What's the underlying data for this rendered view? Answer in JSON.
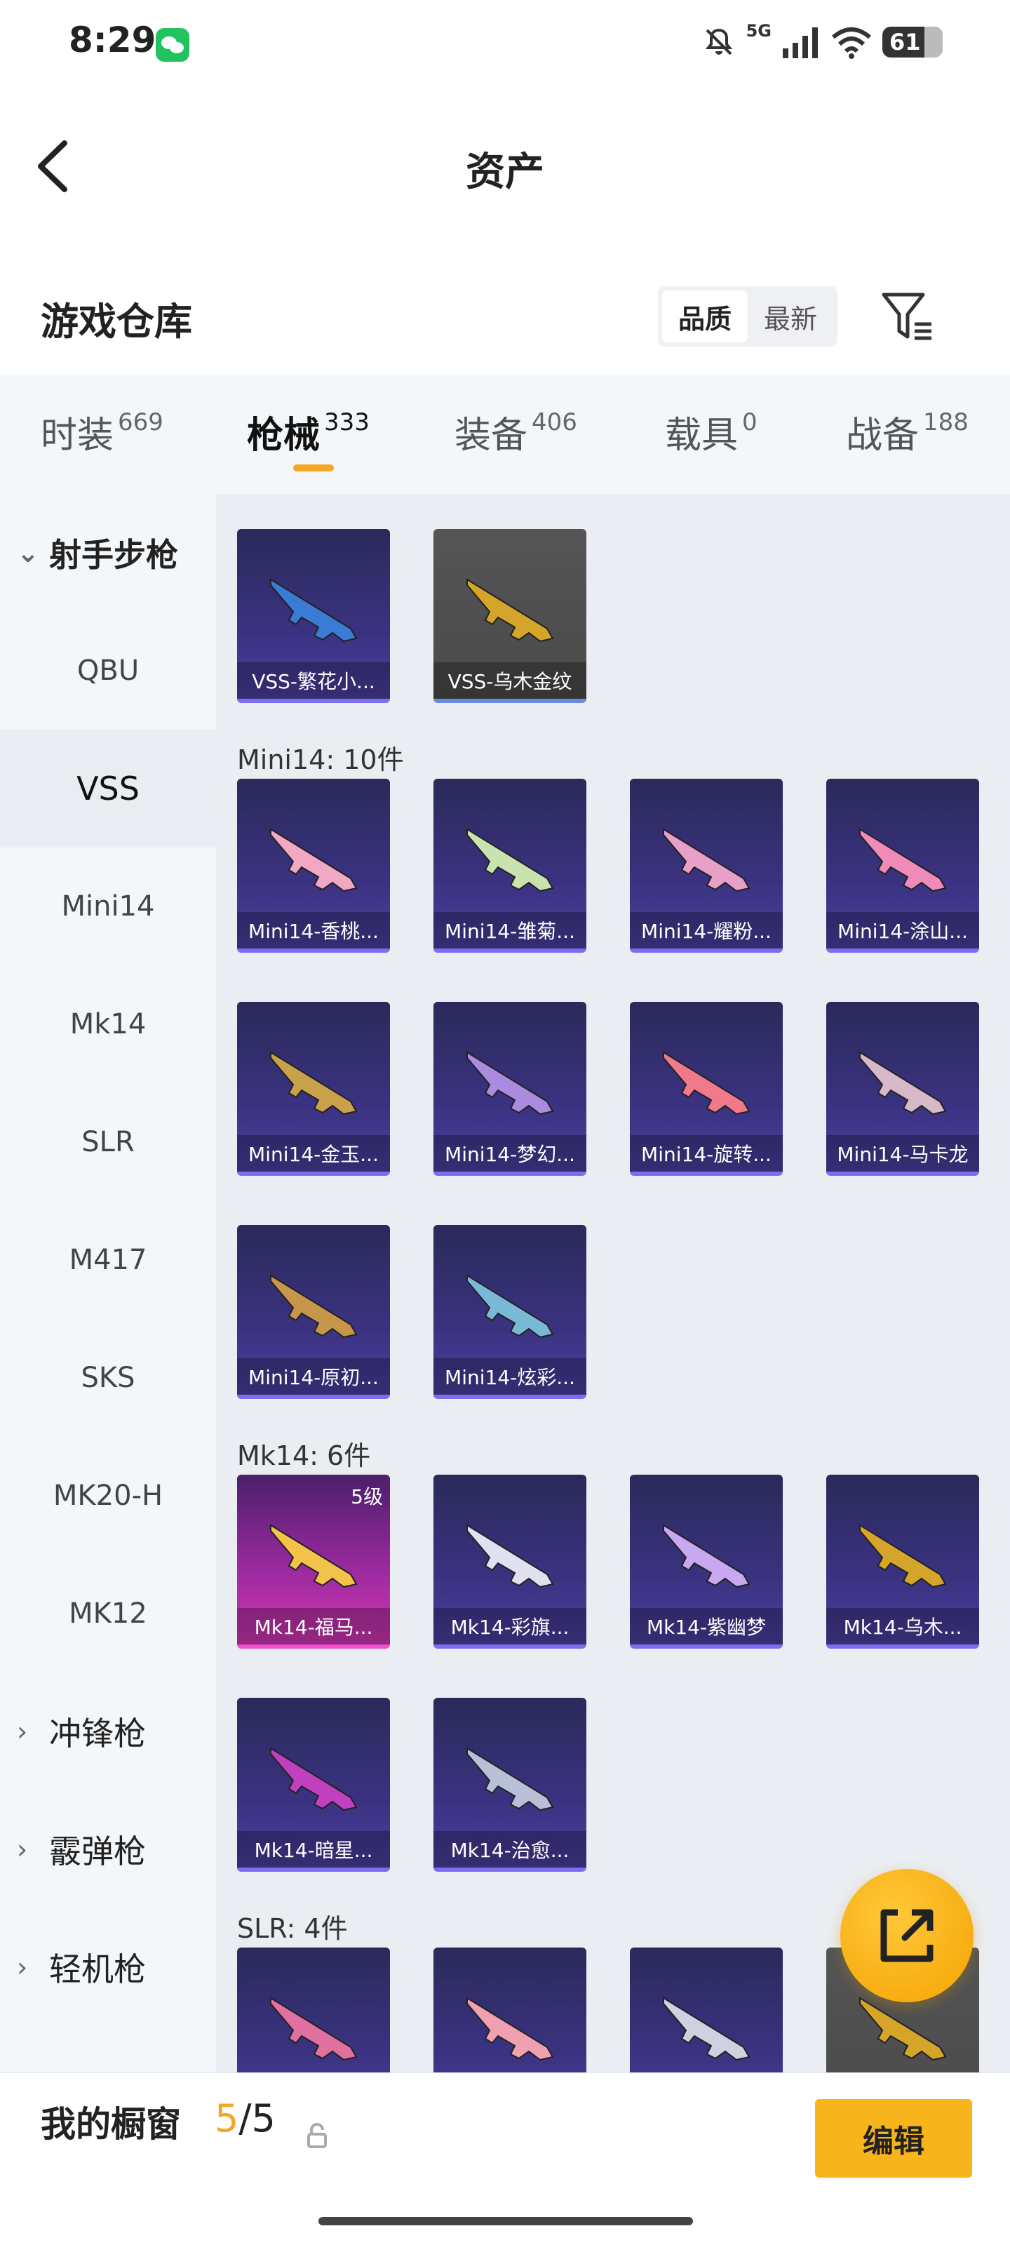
{
  "status_bar": {
    "time": "8:29",
    "battery": "61",
    "network": "5G"
  },
  "header": {
    "title": "资产"
  },
  "warehouse": {
    "title": "游戏仓库",
    "sort_options": [
      "品质",
      "最新"
    ],
    "active_sort": "品质"
  },
  "tabs": [
    {
      "label": "时装",
      "count": "669",
      "active": false
    },
    {
      "label": "枪械",
      "count": "333",
      "active": true
    },
    {
      "label": "装备",
      "count": "406",
      "active": false
    },
    {
      "label": "载具",
      "count": "0",
      "active": false
    },
    {
      "label": "战备",
      "count": "188",
      "active": false
    }
  ],
  "sidebar": {
    "open_category": "射手步枪",
    "items": [
      "QBU",
      "VSS",
      "Mini14",
      "Mk14",
      "SLR",
      "M417",
      "SKS",
      "MK20-H",
      "MK12"
    ],
    "active_item": "VSS",
    "closed_categories": [
      "冲锋枪",
      "霰弹枪",
      "轻机枪"
    ]
  },
  "groups": [
    {
      "label": "",
      "cards": [
        {
          "name": "VSS-繁花小...",
          "style": "purple",
          "color": "#3a7bd5"
        },
        {
          "name": "VSS-乌木金纹",
          "style": "gray",
          "color": "#d4a52a"
        }
      ]
    },
    {
      "label": "Mini14: 10件",
      "cards": [
        {
          "name": "Mini14-香桃...",
          "style": "purple",
          "color": "#f2a7c3"
        },
        {
          "name": "Mini14-雏菊...",
          "style": "purple",
          "color": "#c9e3b0"
        },
        {
          "name": "Mini14-耀粉...",
          "style": "purple",
          "color": "#e8a0c8"
        },
        {
          "name": "Mini14-涂山...",
          "style": "purple",
          "color": "#f08ab8"
        },
        {
          "name": "Mini14-金玉...",
          "style": "purple",
          "color": "#c9a14a"
        },
        {
          "name": "Mini14-梦幻...",
          "style": "purple",
          "color": "#a98be0"
        },
        {
          "name": "Mini14-旋转...",
          "style": "purple",
          "color": "#f07a8a"
        },
        {
          "name": "Mini14-马卡龙",
          "style": "purple",
          "color": "#d6b8c8"
        },
        {
          "name": "Mini14-原初...",
          "style": "purple",
          "color": "#c8964a"
        },
        {
          "name": "Mini14-炫彩...",
          "style": "purple",
          "color": "#7ab8d8"
        }
      ]
    },
    {
      "label": "Mk14: 6件",
      "cards": [
        {
          "name": "Mk14-福马...",
          "style": "pink",
          "color": "#f2c24a",
          "level": "5级"
        },
        {
          "name": "Mk14-彩旗...",
          "style": "purple",
          "color": "#e0e0f0"
        },
        {
          "name": "Mk14-紫幽梦",
          "style": "purple",
          "color": "#c8a8f0"
        },
        {
          "name": "Mk14-乌木...",
          "style": "purple",
          "color": "#d4a52a"
        },
        {
          "name": "Mk14-暗星...",
          "style": "purple",
          "color": "#c040c0"
        },
        {
          "name": "Mk14-治愈...",
          "style": "purple",
          "color": "#b8c0d8"
        }
      ]
    },
    {
      "label": "SLR: 4件",
      "cards": [
        {
          "name": "",
          "style": "purple",
          "color": "#e070a0"
        },
        {
          "name": "",
          "style": "purple",
          "color": "#f0a0b0"
        },
        {
          "name": "",
          "style": "purple",
          "color": "#d0d0e0"
        },
        {
          "name": "",
          "style": "gray",
          "color": "#d4a52a"
        }
      ]
    }
  ],
  "bottom_bar": {
    "label": "我的橱窗",
    "count_current": "5",
    "count_total": "/5",
    "edit_label": "编辑"
  },
  "colors": {
    "accent": "#f5a623",
    "edit_button": "#f7b51b"
  },
  "icons": [
    "back-arrow-icon",
    "filter-icon",
    "share-icon",
    "lock-icon",
    "wechat-icon",
    "battery-icon",
    "wifi-icon",
    "signal-icon",
    "mute-icon"
  ]
}
